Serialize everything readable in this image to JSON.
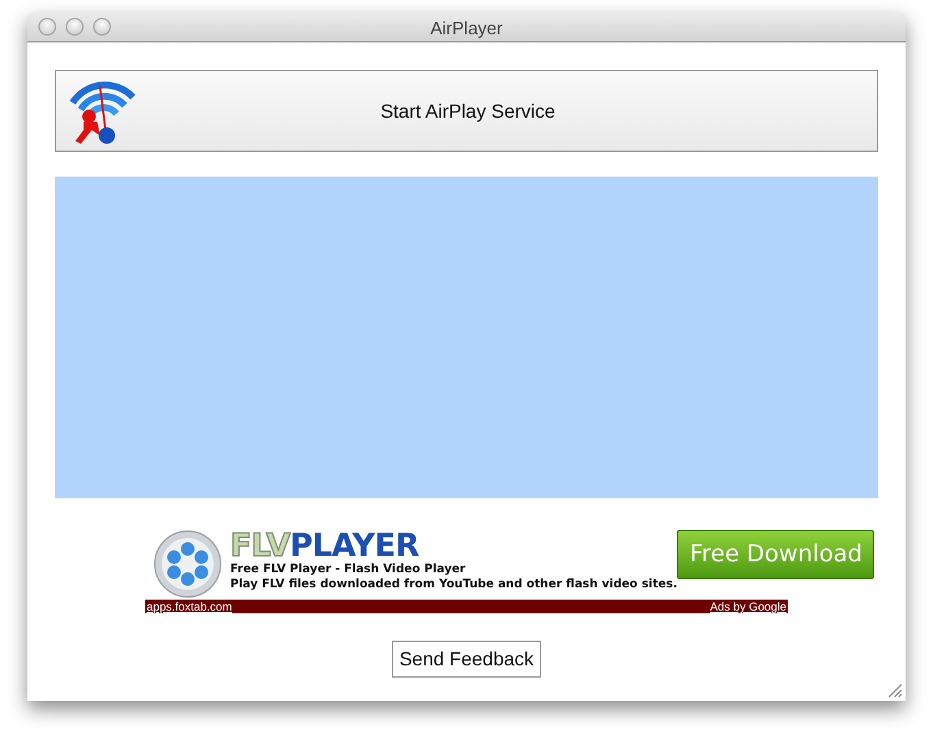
{
  "window": {
    "title": "AirPlayer"
  },
  "start_button": {
    "label": "Start AirPlay Service"
  },
  "ad": {
    "logo_prefix": "FLV",
    "logo_suffix": "PLAYER",
    "headline": "Free FLV Player - Flash Video Player",
    "description": "Play FLV files downloaded from YouTube and other flash video sites.",
    "cta": "Free Download",
    "url": "apps.foxtab.com",
    "attribution": "Ads by Google"
  },
  "feedback_button": {
    "label": "Send Feedback"
  }
}
